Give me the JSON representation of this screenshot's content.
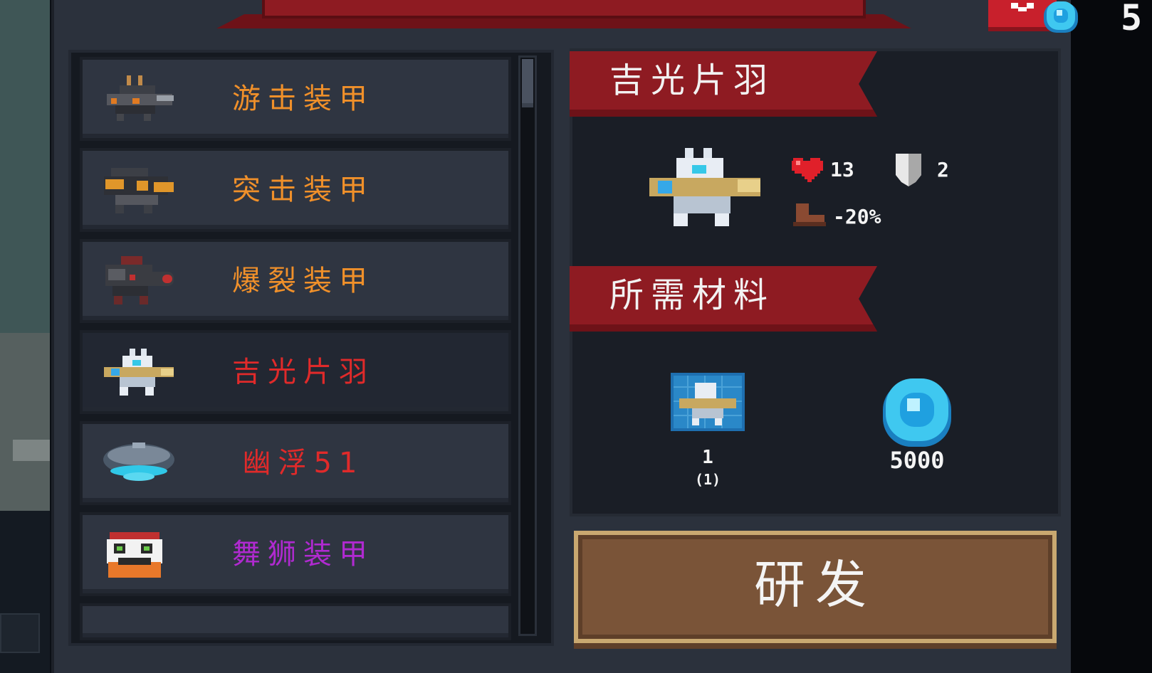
{
  "armor_list": {
    "items": [
      {
        "label": "游击装甲",
        "color": "#f0902a",
        "icon": "guerrilla-mech-icon"
      },
      {
        "label": "突击装甲",
        "color": "#f0902a",
        "icon": "assault-mech-icon"
      },
      {
        "label": "爆裂装甲",
        "color": "#f0902a",
        "icon": "burst-mech-icon"
      },
      {
        "label": "吉光片羽",
        "color": "#e02a2a",
        "icon": "jiguang-mech-icon",
        "selected": true
      },
      {
        "label": "幽浮51",
        "color": "#e02a2a",
        "icon": "ufo-icon"
      },
      {
        "label": "舞狮装甲",
        "color": "#b02ad0",
        "icon": "lion-dance-icon"
      }
    ]
  },
  "detail": {
    "name": "吉光片羽",
    "hp": "13",
    "armor": "2",
    "speed": "-20%"
  },
  "materials": {
    "title": "所需材料",
    "blueprint_need": "1",
    "blueprint_have": "(1)",
    "gems_need": "5000"
  },
  "research_button": "研发",
  "currency": {
    "gems": "5"
  },
  "colors": {
    "ribbon_red": "#8e1b22",
    "button_brown": "#7a5438",
    "gem_blue": "#3fc8f0"
  }
}
